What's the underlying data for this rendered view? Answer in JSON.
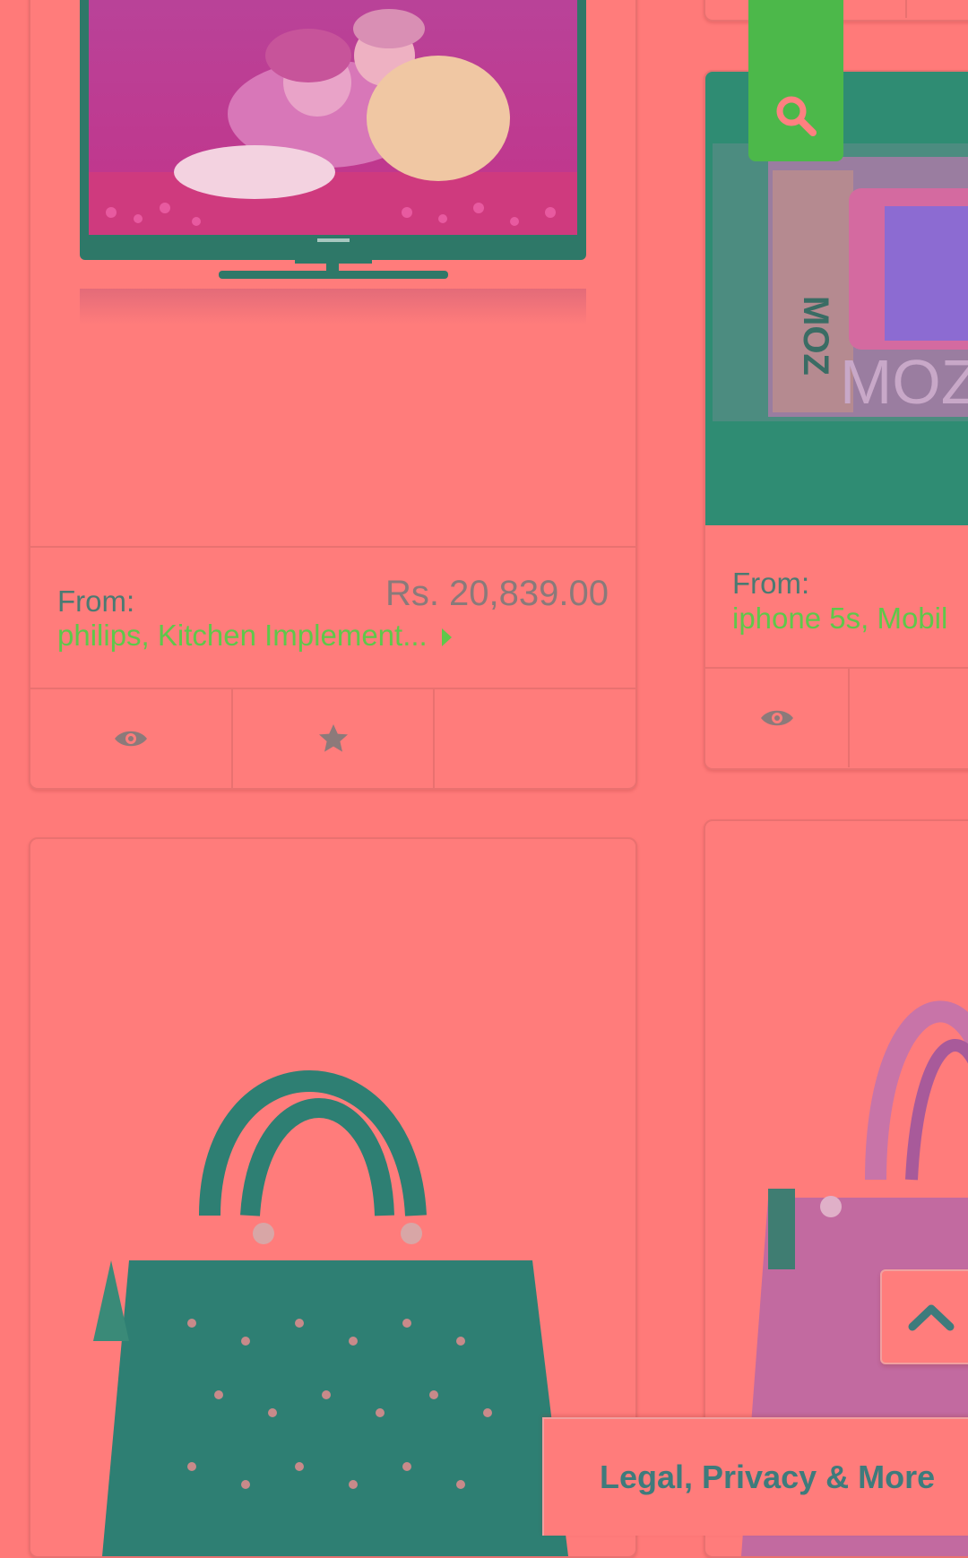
{
  "products": [
    {
      "id": "tv",
      "image_desc": "philips television",
      "from_label": "From:",
      "price": "Rs. 20,839.00",
      "tags": "philips, Kitchen Implement...",
      "actions": [
        "view-icon",
        "star-icon",
        ""
      ]
    },
    {
      "id": "phone",
      "image_desc": "phone with case",
      "from_label": "From:",
      "price": "",
      "tags": "iphone 5s, Mobil",
      "actions": [
        "view-icon",
        ""
      ]
    }
  ],
  "search": {
    "icon": "search-icon"
  },
  "scroll_top": {
    "icon": "chevron-up-icon"
  },
  "footer": {
    "label": "Legal, Privacy & More"
  },
  "colors": {
    "background": "#ff7a79",
    "accent_green": "#4cb84a",
    "teal_text": "#3e7b7c",
    "tag_green": "#5ec84a"
  }
}
